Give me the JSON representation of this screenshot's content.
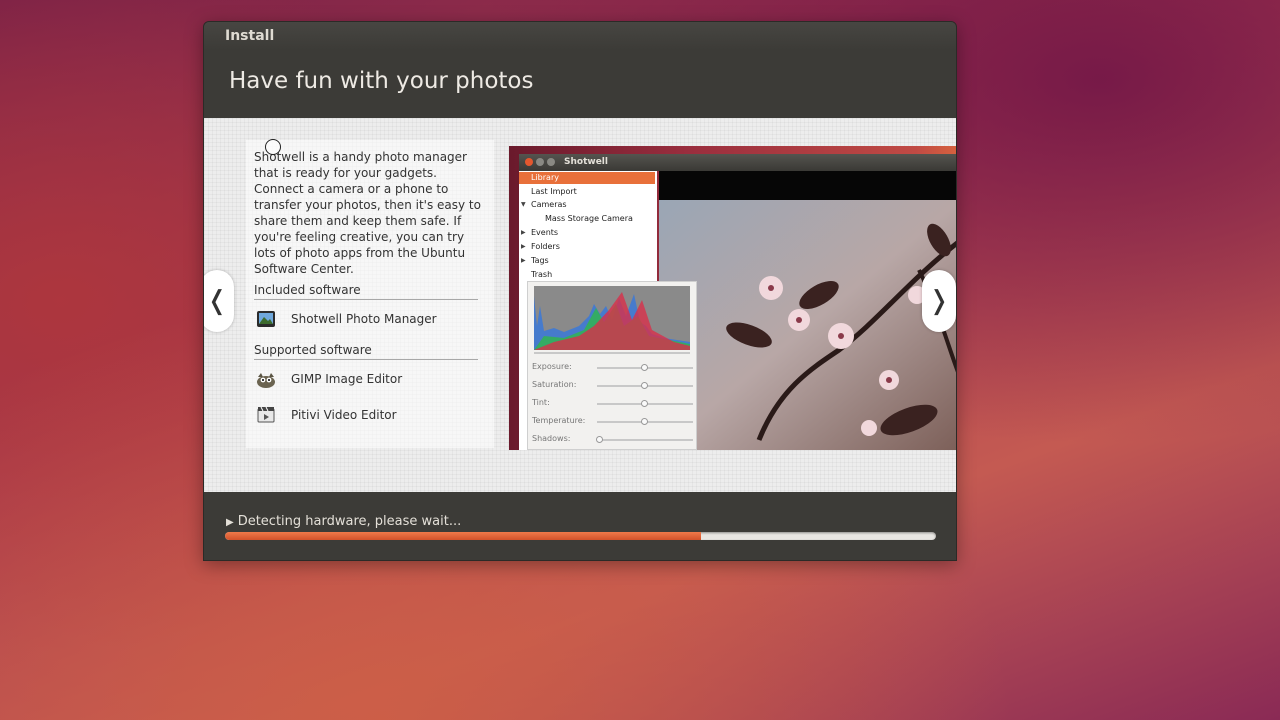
{
  "window": {
    "title": "Install"
  },
  "slide": {
    "heading": "Have fun with your photos",
    "description": "Shotwell is a handy photo manager that is ready for your gadgets. Connect a camera or a phone to transfer your photos, then it's easy to share them and keep them safe. If you're feeling creative, you can try lots of photo apps from the Ubuntu Software Center.",
    "included_label": "Included software",
    "included": [
      {
        "label": "Shotwell Photo Manager",
        "icon": "shotwell-icon"
      }
    ],
    "supported_label": "Supported software",
    "supported": [
      {
        "label": "GIMP Image Editor",
        "icon": "gimp-icon"
      },
      {
        "label": "Pitivi Video Editor",
        "icon": "pitivi-icon"
      }
    ],
    "nav_prev": "❬",
    "nav_next": "❭"
  },
  "screenshot": {
    "app_title": "Shotwell",
    "sidebar": [
      "Library",
      "Last Import",
      "Cameras",
      "Mass Storage Camera",
      "Events",
      "Folders",
      "Tags",
      "Trash"
    ],
    "adjustments": [
      "Exposure:",
      "Saturation:",
      "Tint:",
      "Temperature:",
      "Shadows:"
    ]
  },
  "status": {
    "text": "Detecting hardware, please wait...",
    "progress": 0.67
  },
  "colors": {
    "accent": "#dd4814",
    "progress": "#e8703a",
    "panel": "#3c3b37"
  }
}
